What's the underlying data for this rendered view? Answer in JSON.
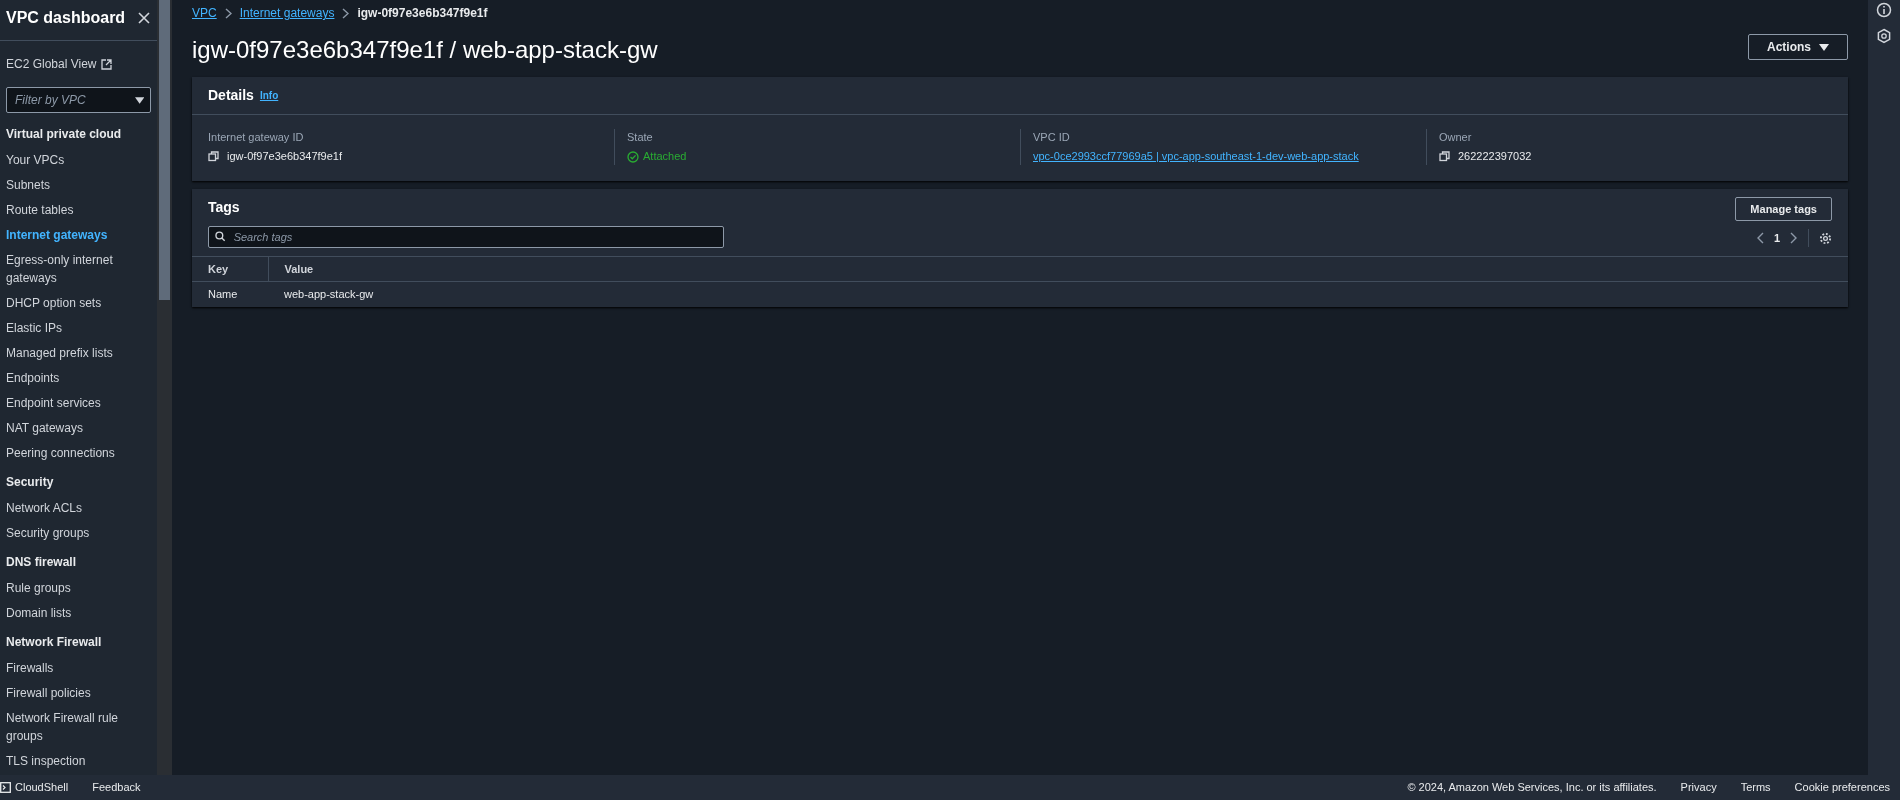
{
  "sidebar": {
    "title": "VPC dashboard",
    "global_view": "EC2 Global View",
    "filter_placeholder": "Filter by VPC",
    "sections": [
      {
        "heading": "Virtual private cloud",
        "items": [
          {
            "label": "Your VPCs",
            "selected": false
          },
          {
            "label": "Subnets",
            "selected": false
          },
          {
            "label": "Route tables",
            "selected": false
          },
          {
            "label": "Internet gateways",
            "selected": true
          },
          {
            "label": "Egress-only internet gateways",
            "selected": false
          },
          {
            "label": "DHCP option sets",
            "selected": false
          },
          {
            "label": "Elastic IPs",
            "selected": false
          },
          {
            "label": "Managed prefix lists",
            "selected": false
          },
          {
            "label": "Endpoints",
            "selected": false
          },
          {
            "label": "Endpoint services",
            "selected": false
          },
          {
            "label": "NAT gateways",
            "selected": false
          },
          {
            "label": "Peering connections",
            "selected": false
          }
        ]
      },
      {
        "heading": "Security",
        "items": [
          {
            "label": "Network ACLs",
            "selected": false
          },
          {
            "label": "Security groups",
            "selected": false
          }
        ]
      },
      {
        "heading": "DNS firewall",
        "items": [
          {
            "label": "Rule groups",
            "selected": false
          },
          {
            "label": "Domain lists",
            "selected": false
          }
        ]
      },
      {
        "heading": "Network Firewall",
        "items": [
          {
            "label": "Firewalls",
            "selected": false
          },
          {
            "label": "Firewall policies",
            "selected": false
          },
          {
            "label": "Network Firewall rule groups",
            "selected": false
          },
          {
            "label": "TLS inspection",
            "selected": false
          }
        ]
      }
    ]
  },
  "breadcrumb": [
    {
      "label": "VPC",
      "kind": "link"
    },
    {
      "label": "Internet gateways",
      "kind": "link"
    },
    {
      "label": "igw-0f97e3e6b347f9e1f",
      "kind": "current"
    }
  ],
  "page_title": "igw-0f97e3e6b347f9e1f / web-app-stack-gw",
  "actions_button": "Actions",
  "details": {
    "title": "Details",
    "info": "Info",
    "fields": [
      {
        "label": "Internet gateway ID",
        "value": "igw-0f97e3e6b347f9e1f",
        "kind": "copy"
      },
      {
        "label": "State",
        "value": "Attached",
        "kind": "status"
      },
      {
        "label": "VPC ID",
        "value": "vpc-0ce2993ccf77969a5 | vpc-app-southeast-1-dev-web-app-stack",
        "kind": "link"
      },
      {
        "label": "Owner",
        "value": "262222397032",
        "kind": "copy"
      }
    ]
  },
  "tags": {
    "title": "Tags",
    "manage_button": "Manage tags",
    "search_placeholder": "Search tags",
    "page": "1",
    "columns": [
      "Key",
      "Value"
    ],
    "rows": [
      [
        "Name",
        "web-app-stack-gw"
      ]
    ]
  },
  "footer": {
    "left": [
      "CloudShell",
      "Feedback"
    ],
    "copyright": "© 2024, Amazon Web Services, Inc. or its affiliates.",
    "links": [
      "Privacy",
      "Terms",
      "Cookie preferences"
    ]
  }
}
